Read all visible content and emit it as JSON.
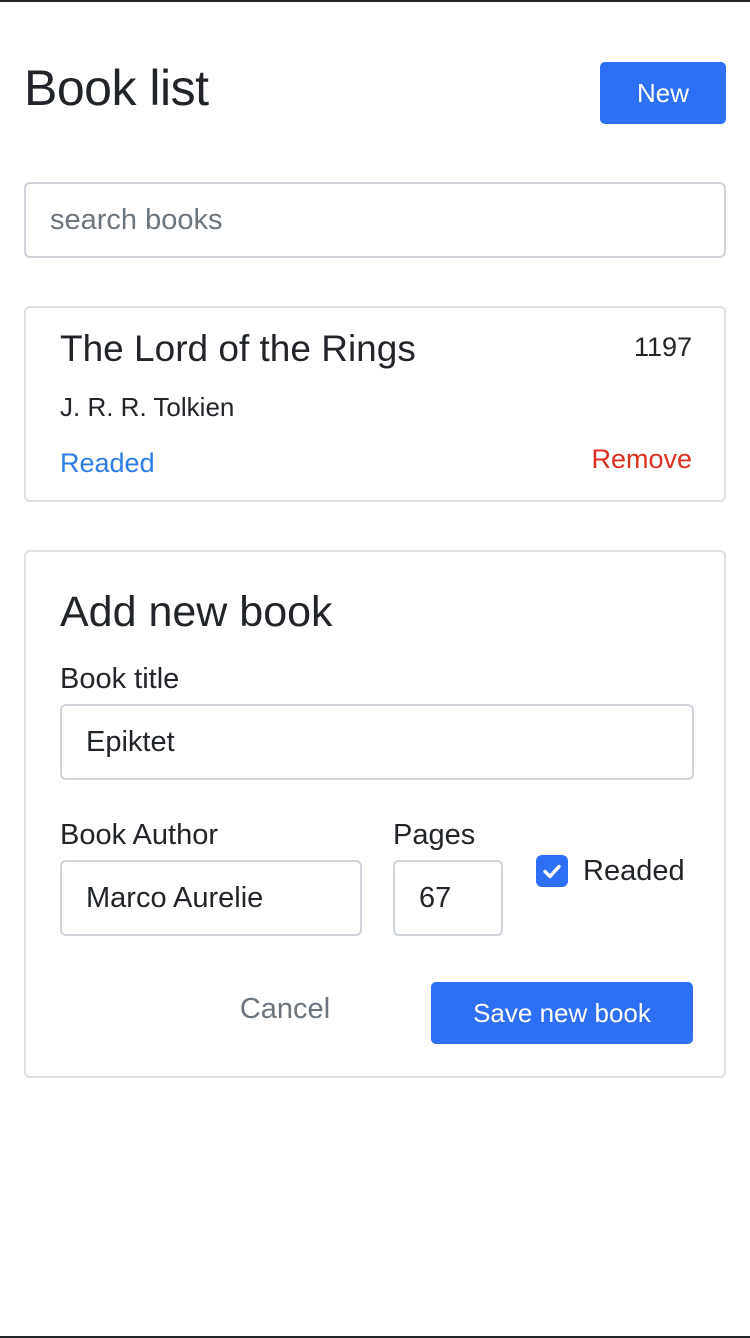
{
  "header": {
    "title": "Book list",
    "new_label": "New"
  },
  "search": {
    "placeholder": "search books",
    "value": ""
  },
  "books": [
    {
      "title": "The Lord of the Rings",
      "pages": "1197",
      "author": "J. R. R. Tolkien",
      "readed_label": "Readed",
      "remove_label": "Remove"
    }
  ],
  "form": {
    "heading": "Add new book",
    "title_label": "Book title",
    "title_value": "Epiktet",
    "author_label": "Book Author",
    "author_value": "Marco Aurelie",
    "pages_label": "Pages",
    "pages_value": "67",
    "readed_label": "Readed",
    "readed_checked": true,
    "cancel_label": "Cancel",
    "save_label": "Save new book"
  },
  "colors": {
    "primary": "#2d6ff5",
    "link": "#2d7de6",
    "danger": "#dc3020",
    "muted": "#6c757d",
    "border": "#dee2e6"
  },
  "icons": {
    "checkbox": "check-icon"
  }
}
